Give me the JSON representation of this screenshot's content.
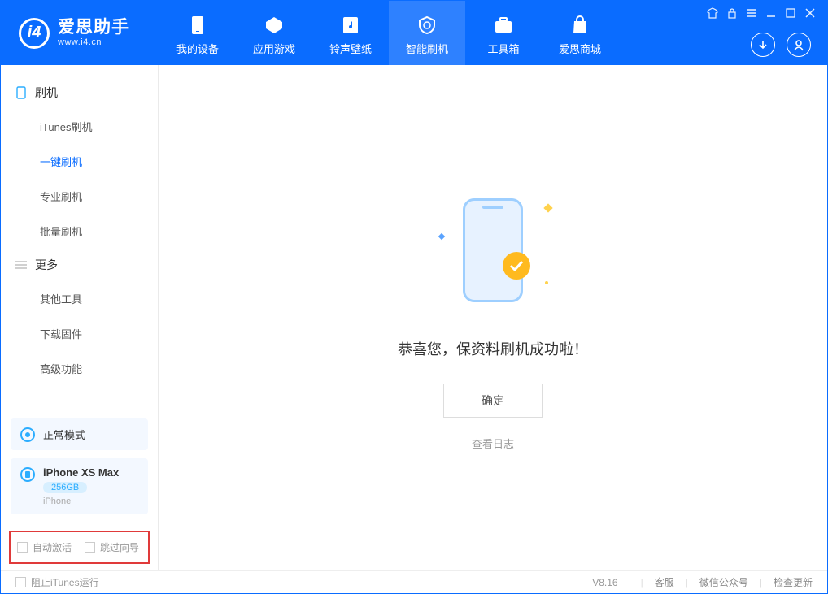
{
  "header": {
    "logo_title": "爱思助手",
    "logo_subtitle": "www.i4.cn",
    "nav": [
      {
        "id": "device",
        "label": "我的设备"
      },
      {
        "id": "apps",
        "label": "应用游戏"
      },
      {
        "id": "rings",
        "label": "铃声壁纸"
      },
      {
        "id": "flash",
        "label": "智能刷机"
      },
      {
        "id": "tools",
        "label": "工具箱"
      },
      {
        "id": "mall",
        "label": "爱思商城"
      }
    ],
    "active_nav_index": 3
  },
  "sidebar": {
    "section1": {
      "title": "刷机",
      "items": [
        "iTunes刷机",
        "一键刷机",
        "专业刷机",
        "批量刷机"
      ],
      "selected_index": 1
    },
    "section2": {
      "title": "更多",
      "items": [
        "其他工具",
        "下载固件",
        "高级功能"
      ]
    },
    "mode_card": {
      "label": "正常模式"
    },
    "device_card": {
      "name": "iPhone XS Max",
      "storage": "256GB",
      "type": "iPhone"
    },
    "options": {
      "auto_activate": "自动激活",
      "skip_guide": "跳过向导"
    }
  },
  "main": {
    "success_message": "恭喜您，保资料刷机成功啦！",
    "ok_button": "确定",
    "view_log": "查看日志"
  },
  "footer": {
    "stop_itunes": "阻止iTunes运行",
    "version": "V8.16",
    "links": [
      "客服",
      "微信公众号",
      "检查更新"
    ]
  }
}
